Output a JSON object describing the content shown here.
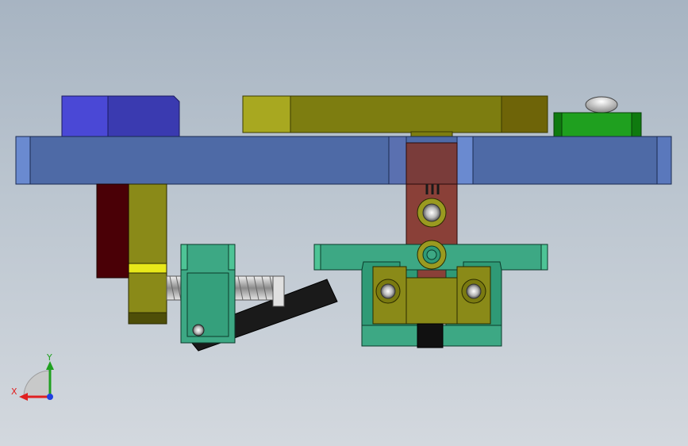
{
  "viewport": {
    "background_top": "#a7b4c2",
    "background_bottom": "#d3d8de"
  },
  "triad": {
    "x_label": "X",
    "y_label": "Y",
    "x_color": "#e02020",
    "y_color": "#20a020",
    "z_color": "#2040e0"
  },
  "parts": {
    "base_plate_color": "#4e6aa6",
    "blue_block_color": "#3c3fb8",
    "olive_bar_color": "#7a7a0e",
    "green_block_color": "#1f9a1f",
    "bracket_color": "#3da884",
    "red_block_color": "#7a3a3a",
    "maroon_block_color": "#4a0008",
    "knob_color": "#5a5a5a"
  }
}
